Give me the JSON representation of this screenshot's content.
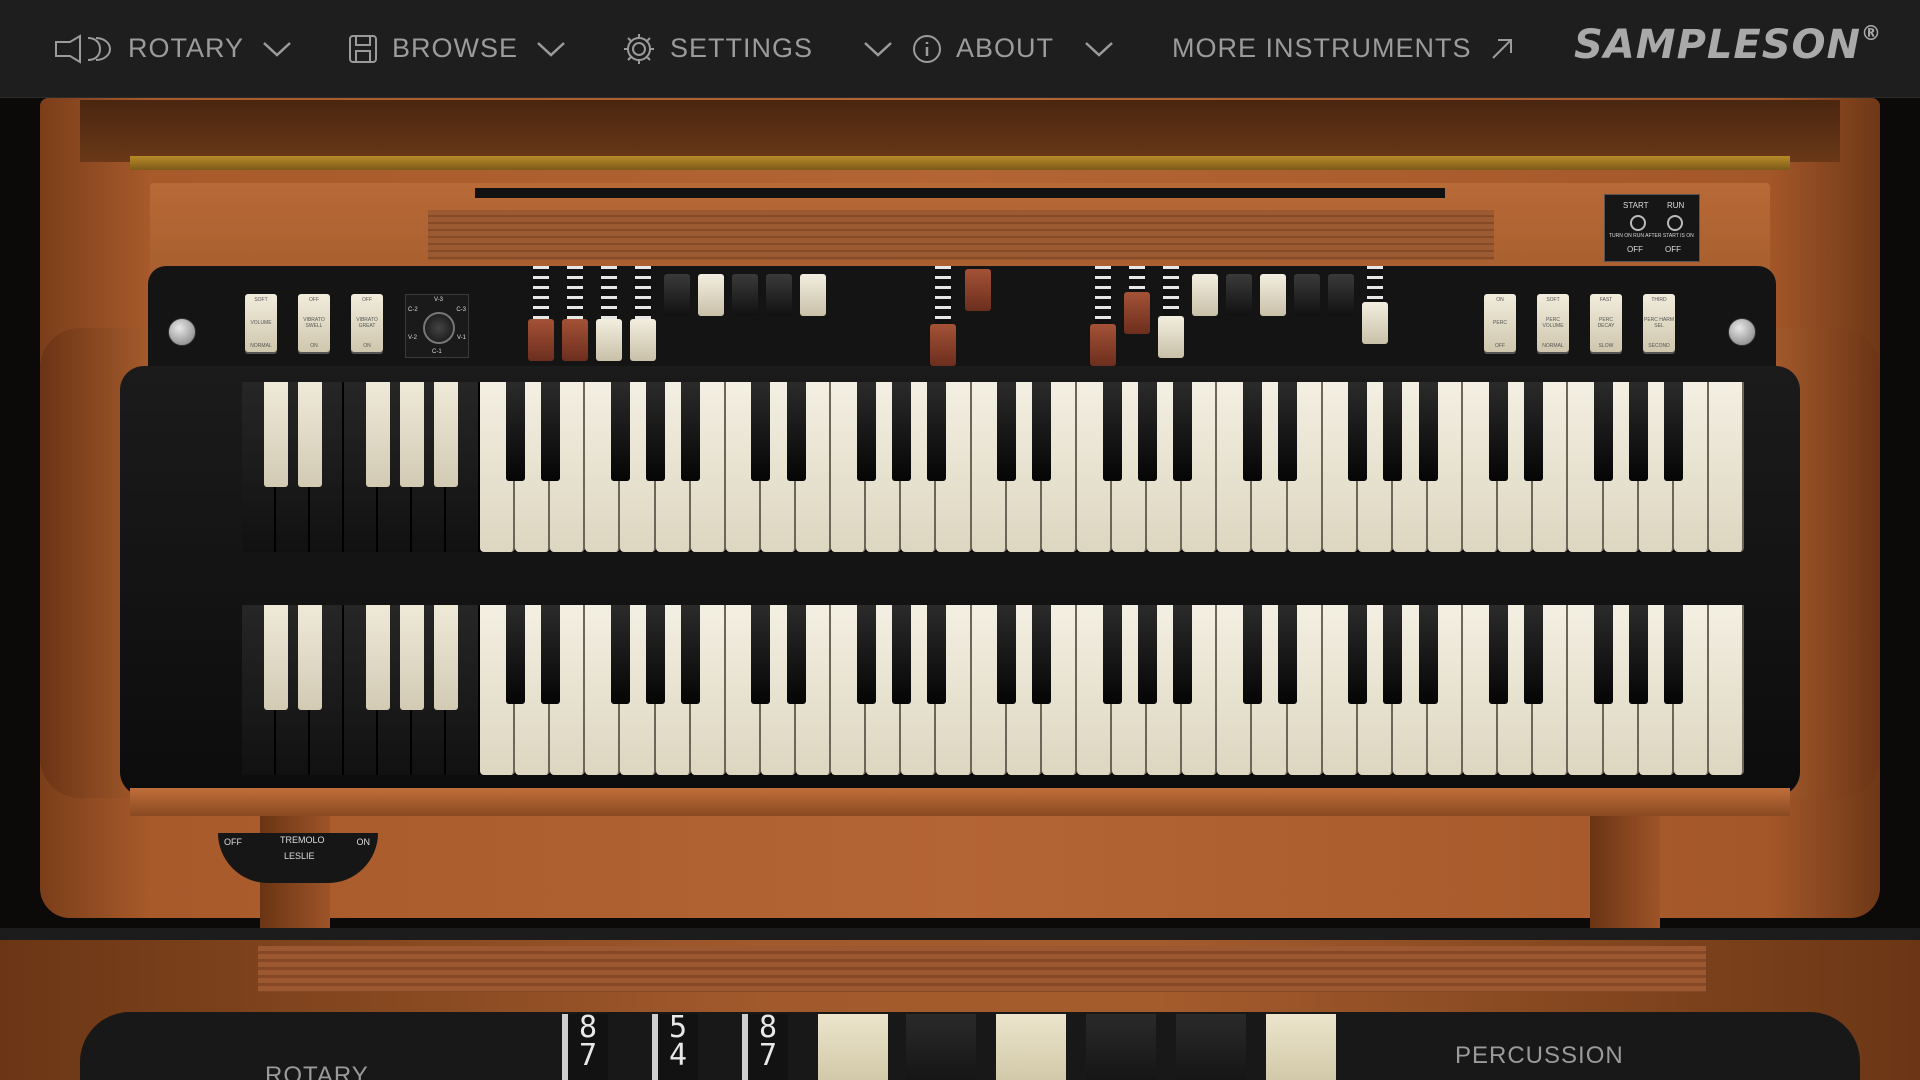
{
  "nav": {
    "rotary": "ROTARY",
    "browse": "BROWSE",
    "settings": "SETTINGS",
    "about": "ABOUT",
    "more_instruments": "MORE INSTRUMENTS",
    "brand": "SAMPLESON",
    "brand_mark": "®"
  },
  "organ": {
    "left_tabs": [
      {
        "top": "SOFT",
        "mid": "VOLUME",
        "bottom": "NORMAL"
      },
      {
        "top": "OFF",
        "mid": "VIBRATO SWELL",
        "bottom": "ON"
      },
      {
        "top": "OFF",
        "mid": "VIBRATO GREAT",
        "bottom": "ON"
      }
    ],
    "vibrato_knob": {
      "tl": "C-2",
      "tr": "V-3",
      "l": "V-2",
      "r": "C-3",
      "bl": "V-1",
      "b": "C-1"
    },
    "right_tabs": [
      {
        "top": "ON",
        "mid": "PERC",
        "bottom": "OFF"
      },
      {
        "top": "SOFT",
        "mid": "PERC VOLUME",
        "bottom": "NORMAL"
      },
      {
        "top": "FAST",
        "mid": "PERC DECAY",
        "bottom": "SLOW"
      },
      {
        "top": "THIRD",
        "mid": "PERC HARM SEL",
        "bottom": "SECOND"
      }
    ],
    "start_run": {
      "start": "START",
      "run": "RUN",
      "note": "TURN ON RUN AFTER START IS ON",
      "off1": "OFF",
      "off2": "OFF"
    },
    "tremolo": {
      "off": "OFF",
      "label": "TREMOLO",
      "sub": "LESLIE",
      "on": "ON"
    }
  },
  "bottom": {
    "rotary_label": "ROTARY",
    "percussion_label": "PERCUSSION",
    "drawbar_numbers": [
      [
        "8",
        "7"
      ],
      [
        "5",
        "4"
      ],
      [
        "8",
        "7"
      ]
    ]
  },
  "colors": {
    "nav_bg": "#1e1e1e",
    "nav_text": "#9b9b9b",
    "wood": "#b46535"
  }
}
